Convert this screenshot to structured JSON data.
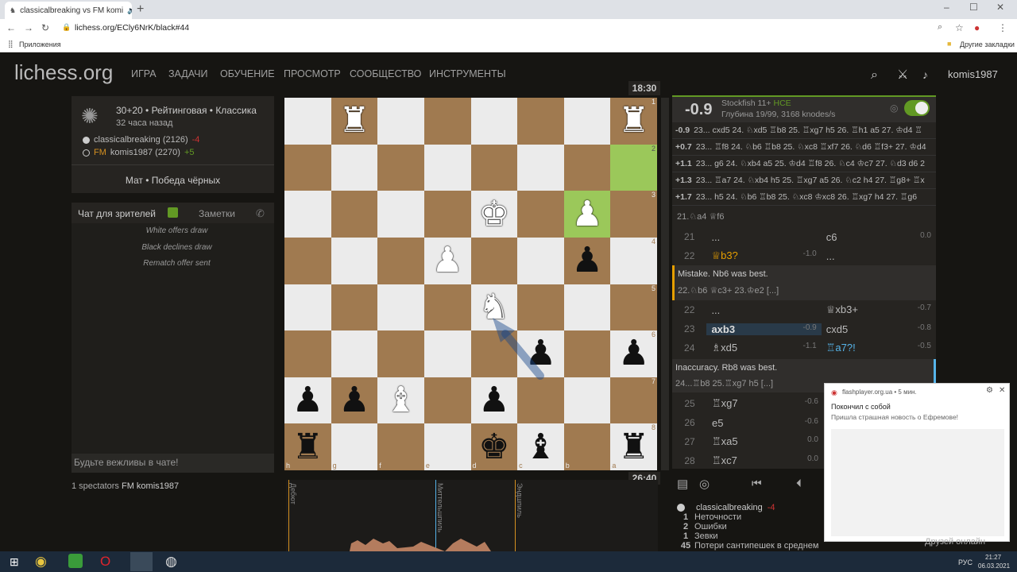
{
  "browser": {
    "tab_title": "classicalbreaking vs FM komi",
    "url": "lichess.org/ECly6NrK/black#44",
    "bookmarks_apps": "Приложения",
    "bookmarks_other": "Другие закладки"
  },
  "site": {
    "logo": "lichess.org",
    "nav": [
      "ИГРА",
      "ЗАДАЧИ",
      "ОБУЧЕНИЕ",
      "ПРОСМОТР",
      "СООБЩЕСТВО",
      "ИНСТРУМЕНТЫ"
    ],
    "username": "komis1987"
  },
  "game": {
    "type": "30+20 • Рейтинговая • Классика",
    "time": "32 часа назад",
    "white_name": "classicalbreaking (2126)",
    "white_diff": "-4",
    "black_title": "FM",
    "black_name": "komis1987 (2270)",
    "black_diff": "+5",
    "result": "Мат • Победа чёрных"
  },
  "chat": {
    "tab_spectators": "Чат для зрителей",
    "tab_notes": "Заметки",
    "messages": [
      "White offers draw",
      "Black declines draw",
      "Rematch offer sent"
    ],
    "placeholder": "Будьте вежливы в чате!",
    "spectators": "1 spectators",
    "spectator_name": "FM komis1987"
  },
  "clocks": {
    "top": "18:30",
    "bottom": "26:40"
  },
  "board": {
    "ranks": [
      "1",
      "2",
      "3",
      "4",
      "5",
      "6",
      "7",
      "8"
    ],
    "files": [
      "h",
      "g",
      "f",
      "e",
      "d",
      "c",
      "b",
      "a"
    ]
  },
  "engine": {
    "eval": "-0.9",
    "name": "Stockfish 11+",
    "hce": "HCE",
    "depth": "Глубина 19/99, 3168 knodes/s",
    "lines": [
      {
        "e": "-0.9",
        "m": "23... cxd5 24. ♘xd5 ♖b8 25. ♖xg7 h5 26. ♖h1 a5 27. ♔d4 ♖"
      },
      {
        "e": "+0.7",
        "m": "23... ♖f8 24. ♘b6 ♖b8 25. ♘xc8 ♖xf7 26. ♘d6 ♖f3+ 27. ♔d4"
      },
      {
        "e": "+1.1",
        "m": "23... g6 24. ♘xb4 a5 25. ♔d4 ♖f8 26. ♘c4 ♔c7 27. ♘d3 d6 2"
      },
      {
        "e": "+1.3",
        "m": "23... ♖a7 24. ♘xb4 h5 25. ♖xg7 a5 26. ♘c2 h4 27. ♖g8+ ♖x"
      },
      {
        "e": "+1.7",
        "m": "23... h5 24. ♘b6 ♖b8 25. ♘xc8 ♔xc8 26. ♖xg7 h4 27. ♖g6"
      }
    ]
  },
  "moves": {
    "context": "21.♘a4 ♕f6",
    "rows1": [
      {
        "n": "21",
        "w": "...",
        "we": "",
        "b": "c6",
        "be": "0.0"
      },
      {
        "n": "22",
        "w": "♕b3?",
        "we": "-1.0",
        "b": "...",
        "be": ""
      }
    ],
    "comment1": "Mistake. Nb6 was best.",
    "comment1b": "22.♘b6 ♕c3+ 23.♔e2 [...]",
    "rows2": [
      {
        "n": "22",
        "w": "...",
        "we": "",
        "b": "♕xb3+",
        "be": "-0.7"
      },
      {
        "n": "23",
        "w": "axb3",
        "we": "-0.9",
        "b": "cxd5",
        "be": "-0.8"
      },
      {
        "n": "24",
        "w": "♗xd5",
        "we": "-1.1",
        "b": "♖a7?!",
        "be": "-0.5"
      }
    ],
    "comment2": "Inaccuracy. Rb8 was best.",
    "comment2b": "24...♖b8 25.♖xg7 h5 [...]",
    "rows3": [
      {
        "n": "25",
        "w": "♖xg7",
        "we": "-0.6"
      },
      {
        "n": "26",
        "w": "e5",
        "we": "-0.6"
      },
      {
        "n": "27",
        "w": "♖xa5",
        "we": "0.0"
      },
      {
        "n": "28",
        "w": "♖xc7",
        "we": "0.0"
      }
    ]
  },
  "chart": {
    "labels": [
      "Дебют",
      "Миттельшпиль",
      "Эндшпиль"
    ]
  },
  "summary": {
    "player": "classicalbreaking",
    "diff": "-4",
    "rows": [
      {
        "n": "1",
        "t": "Неточности"
      },
      {
        "n": "2",
        "t": "Ошибки"
      },
      {
        "n": "1",
        "t": "Зевки"
      },
      {
        "n": "45",
        "t": "Потери сантипешек в среднем"
      }
    ]
  },
  "notification": {
    "source": "flashplayer.org.ua • 5 мин.",
    "title": "Покончил с собой",
    "body": "Пришла страшная новость о Ефремове!",
    "friends": "Друзей онлайн"
  },
  "taskbar": {
    "lang": "РУС",
    "time": "21:27",
    "date": "06.03.2021"
  },
  "colors": {
    "bg": "#161512",
    "panel": "#262421",
    "light_sq": "#ebebeb",
    "dark_sq": "#a07a50",
    "highlight": "#9bc85a",
    "accent": "#629924"
  }
}
